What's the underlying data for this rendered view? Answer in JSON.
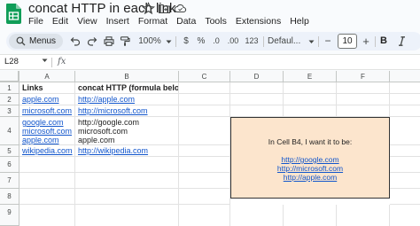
{
  "app": {
    "title": "concat HTTP in each link",
    "menu": [
      "File",
      "Edit",
      "View",
      "Insert",
      "Format",
      "Data",
      "Tools",
      "Extensions",
      "Help"
    ]
  },
  "toolbar": {
    "search_label": "Menus",
    "zoom": "100%",
    "currency": "$",
    "percent": "%",
    "decrease_decimal": ".0",
    "increase_decimal": ".00",
    "number_format": "123",
    "font": "Defaul...",
    "minus": "−",
    "font_size": "10",
    "plus": "+",
    "bold": "B"
  },
  "formula_bar": {
    "name_box": "L28",
    "fx": "fx",
    "content": ""
  },
  "grid": {
    "columns": [
      "A",
      "B",
      "C",
      "D",
      "E",
      "F"
    ],
    "rows": [
      "1",
      "2",
      "3",
      "4",
      "5",
      "6",
      "7",
      "8",
      "9"
    ],
    "cells": {
      "A1": "Links",
      "B1": "concat HTTP (formula below)",
      "A2": "apple.com",
      "B2": "http://apple.com",
      "A3": "microsoft.com",
      "B3": "http://microsoft.com",
      "A4": [
        "google.com",
        "microsoft.com",
        "apple.com"
      ],
      "B4": [
        "http://google.com",
        "microsoft.com",
        "apple.com"
      ],
      "A5": "wikipedia.com",
      "B5": "http://wikipedia.com"
    }
  },
  "note_box": {
    "line1": "In Cell B4, I want it to be:",
    "links": [
      "http://google.com",
      "http://microsoft.com",
      "http://apple.com"
    ],
    "bg_color": "#fce5cd"
  },
  "colors": {
    "link": "#1155cc",
    "sheets_green": "#0f9d58",
    "toolbar_bg": "#edf2fa"
  }
}
